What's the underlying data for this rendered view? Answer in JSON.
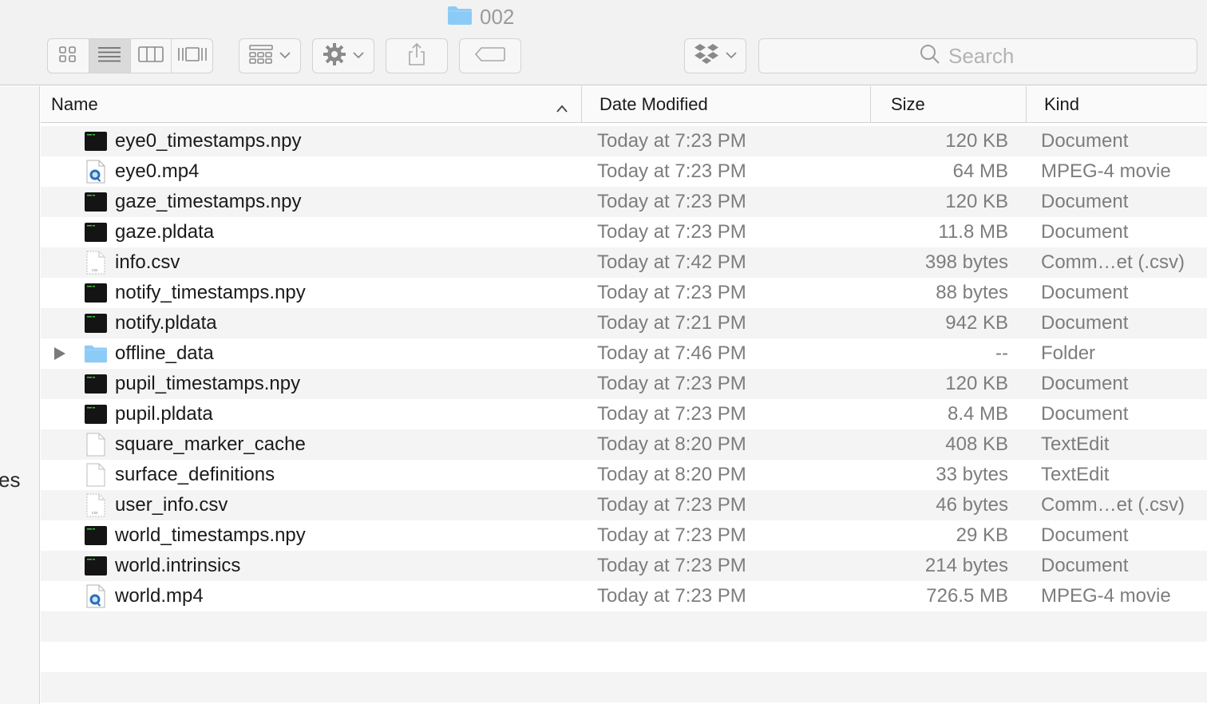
{
  "window": {
    "title": "002"
  },
  "toolbar": {
    "view_modes": [
      {
        "name": "icon-view",
        "icon": "grid-icon",
        "active": false
      },
      {
        "name": "list-view",
        "icon": "list-icon",
        "active": true
      },
      {
        "name": "column-view",
        "icon": "columns-icon",
        "active": false
      },
      {
        "name": "gallery-view",
        "icon": "gallery-icon",
        "active": false
      }
    ],
    "group_icon": "group-grid-icon",
    "action_icon": "gear-icon",
    "share_icon": "share-icon",
    "tag_icon": "tag-icon",
    "dropbox_icon": "dropbox-icon"
  },
  "search": {
    "placeholder": "Search"
  },
  "sidebar": {
    "visible_fragment": "es"
  },
  "columns": {
    "name": "Name",
    "date": "Date Modified",
    "size": "Size",
    "kind": "Kind",
    "sort_column": "Name",
    "sort_direction": "ascending"
  },
  "files": [
    {
      "name": "eye0_timestamps.npy",
      "date": "Today at 7:23 PM",
      "size": "120 KB",
      "kind": "Document",
      "icon": "exec-doc-icon"
    },
    {
      "name": "eye0.mp4",
      "date": "Today at 7:23 PM",
      "size": "64 MB",
      "kind": "MPEG-4 movie",
      "icon": "movie-file-icon"
    },
    {
      "name": "gaze_timestamps.npy",
      "date": "Today at 7:23 PM",
      "size": "120 KB",
      "kind": "Document",
      "icon": "exec-doc-icon"
    },
    {
      "name": "gaze.pldata",
      "date": "Today at 7:23 PM",
      "size": "11.8 MB",
      "kind": "Document",
      "icon": "exec-doc-icon"
    },
    {
      "name": "info.csv",
      "date": "Today at 7:42 PM",
      "size": "398 bytes",
      "kind": "Comm…et (.csv)",
      "icon": "csv-file-icon"
    },
    {
      "name": "notify_timestamps.npy",
      "date": "Today at 7:23 PM",
      "size": "88 bytes",
      "kind": "Document",
      "icon": "exec-doc-icon"
    },
    {
      "name": "notify.pldata",
      "date": "Today at 7:21 PM",
      "size": "942 KB",
      "kind": "Document",
      "icon": "exec-doc-icon"
    },
    {
      "name": "offline_data",
      "date": "Today at 7:46 PM",
      "size": "--",
      "kind": "Folder",
      "icon": "folder-icon",
      "expandable": true
    },
    {
      "name": "pupil_timestamps.npy",
      "date": "Today at 7:23 PM",
      "size": "120 KB",
      "kind": "Document",
      "icon": "exec-doc-icon"
    },
    {
      "name": "pupil.pldata",
      "date": "Today at 7:23 PM",
      "size": "8.4 MB",
      "kind": "Document",
      "icon": "exec-doc-icon"
    },
    {
      "name": "square_marker_cache",
      "date": "Today at 8:20 PM",
      "size": "408 KB",
      "kind": "TextEdit",
      "icon": "text-file-icon"
    },
    {
      "name": "surface_definitions",
      "date": "Today at 8:20 PM",
      "size": "33 bytes",
      "kind": "TextEdit",
      "icon": "text-file-icon"
    },
    {
      "name": "user_info.csv",
      "date": "Today at 7:23 PM",
      "size": "46 bytes",
      "kind": "Comm…et (.csv)",
      "icon": "csv-file-icon"
    },
    {
      "name": "world_timestamps.npy",
      "date": "Today at 7:23 PM",
      "size": "29 KB",
      "kind": "Document",
      "icon": "exec-doc-icon"
    },
    {
      "name": "world.intrinsics",
      "date": "Today at 7:23 PM",
      "size": "214 bytes",
      "kind": "Document",
      "icon": "exec-doc-icon"
    },
    {
      "name": "world.mp4",
      "date": "Today at 7:23 PM",
      "size": "726.5 MB",
      "kind": "MPEG-4 movie",
      "icon": "movie-file-icon"
    }
  ],
  "empty_rows": 3,
  "colors": {
    "folder": "#8ccbf6",
    "row_stripe": "#f4f4f4",
    "secondary_text": "#7d7d7d"
  }
}
